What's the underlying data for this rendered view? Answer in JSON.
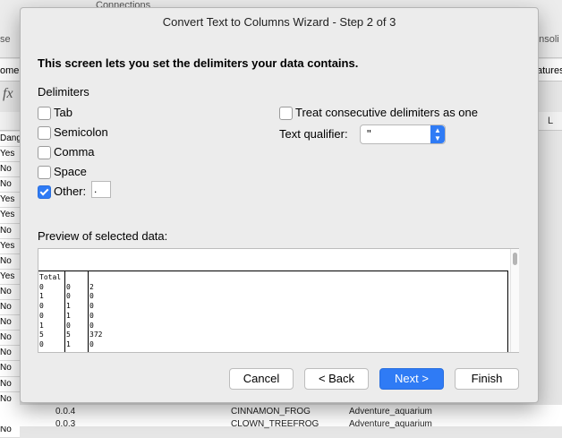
{
  "background": {
    "ribbon_connections": "Connections",
    "ribbon_left": "se",
    "ribbon_right": "onsoli",
    "formula_left": "ome",
    "formula_right": "atures",
    "fx": "fx",
    "column_letter": "L",
    "row_values": [
      "Dang",
      "Yes",
      "No",
      "No",
      "Yes",
      "Yes",
      "No",
      "Yes",
      "No",
      "Yes",
      "No",
      "No",
      "No",
      "No",
      "No",
      "No",
      "No",
      "No",
      "No",
      "No"
    ],
    "bottom_cells": [
      {
        "a": "0.0.4",
        "b": "CINNAMON_FROG",
        "c": "Adventure_aquarium"
      },
      {
        "a": "0.0.3",
        "b": "CLOWN_TREEFROG",
        "c": "Adventure_aquarium"
      }
    ]
  },
  "dialog": {
    "title": "Convert Text to Columns Wizard - Step 2 of 3",
    "heading": "This screen lets you set the delimiters your data contains.",
    "delimiters_label": "Delimiters",
    "delimiters": [
      {
        "label": "Tab",
        "checked": false
      },
      {
        "label": "Semicolon",
        "checked": false
      },
      {
        "label": "Comma",
        "checked": false
      },
      {
        "label": "Space",
        "checked": false
      },
      {
        "label": "Other:",
        "checked": true
      }
    ],
    "other_value": ".",
    "consecutive_label": "Treat consecutive delimiters as one",
    "consecutive_checked": false,
    "text_qualifier_label": "Text qualifier:",
    "text_qualifier_value": "\"",
    "preview_label": "Preview of selected data:",
    "preview_columns": [
      [
        "Total",
        "0",
        "1",
        "0",
        "0",
        "1",
        "5",
        "0"
      ],
      [
        "",
        "0",
        "0",
        "1",
        "1",
        "0",
        "5",
        "1"
      ],
      [
        "",
        "2",
        "0",
        "0",
        "0",
        "0",
        "372",
        "0"
      ]
    ],
    "buttons": {
      "cancel": "Cancel",
      "back": "< Back",
      "next": "Next >",
      "finish": "Finish"
    }
  }
}
